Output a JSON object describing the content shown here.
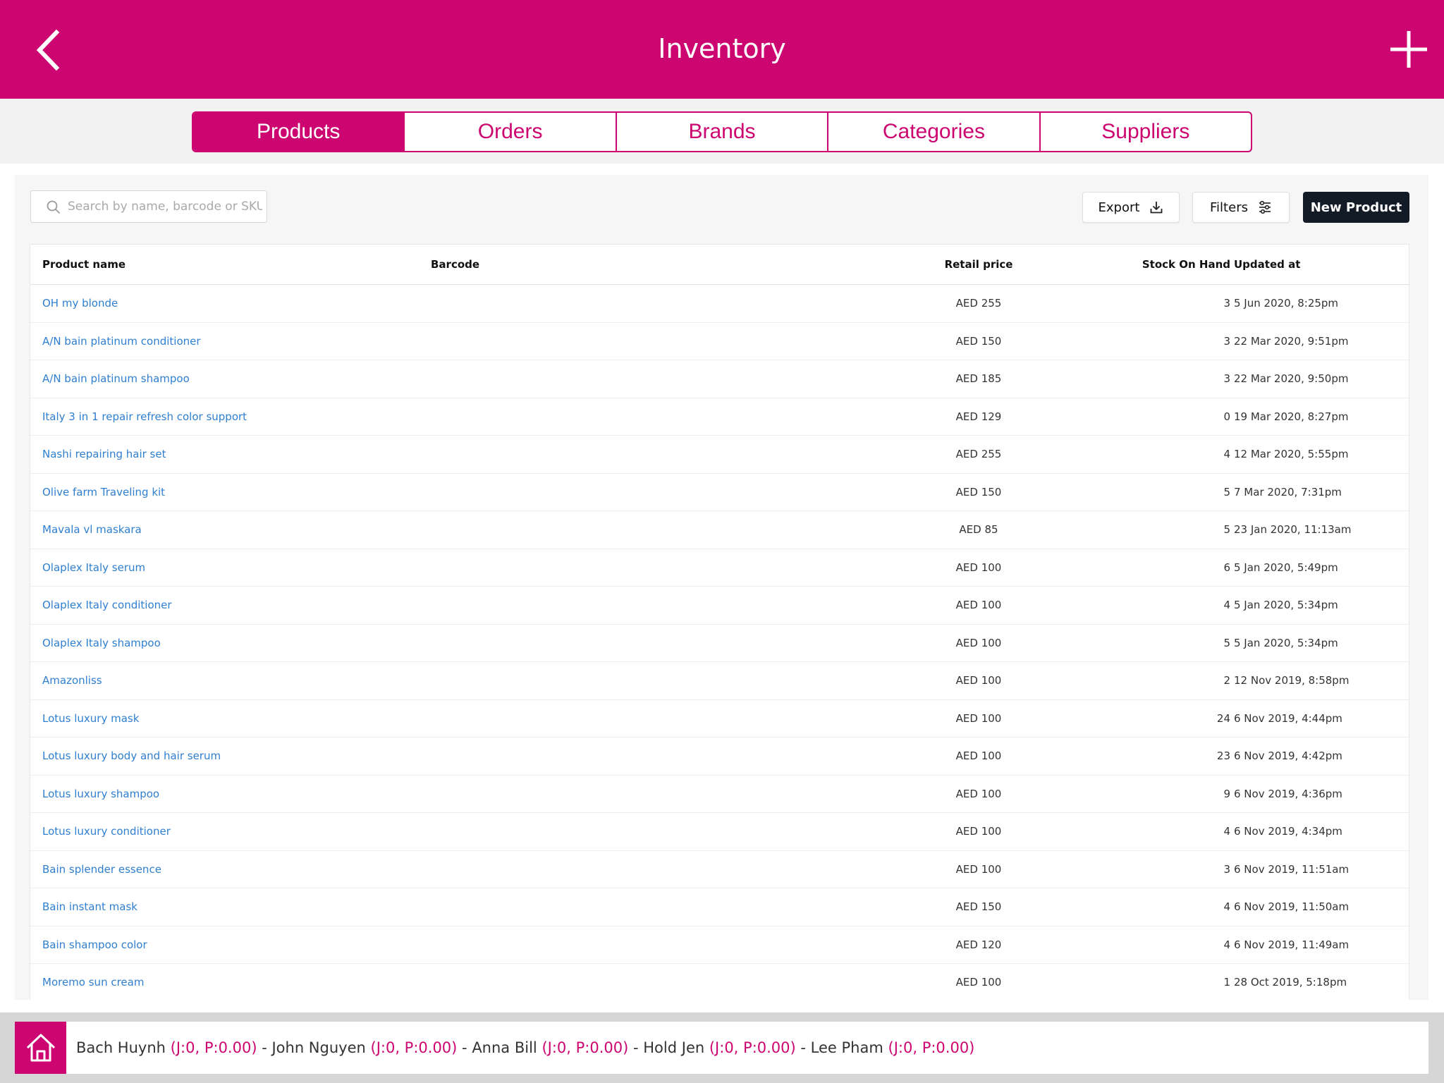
{
  "header": {
    "title": "Inventory",
    "accent_color": "#cc0570",
    "back_icon": "chevron-left-icon",
    "add_icon": "plus-icon"
  },
  "tabs": [
    {
      "label": "Products",
      "active": true
    },
    {
      "label": "Orders",
      "active": false
    },
    {
      "label": "Brands",
      "active": false
    },
    {
      "label": "Categories",
      "active": false
    },
    {
      "label": "Suppliers",
      "active": false
    }
  ],
  "toolbar": {
    "search_placeholder": "Search by name, barcode or SKU",
    "export_label": "Export",
    "filters_label": "Filters",
    "new_product_label": "New Product"
  },
  "table": {
    "columns": [
      "Product name",
      "Barcode",
      "Retail price",
      "Stock On Hand",
      "Updated at"
    ],
    "rows": [
      {
        "name": "OH my blonde",
        "barcode": "",
        "price": "AED 255",
        "stock": "3",
        "updated": "5 Jun 2020, 8:25pm"
      },
      {
        "name": "A/N bain platinum conditioner",
        "barcode": "",
        "price": "AED 150",
        "stock": "3",
        "updated": "22 Mar 2020, 9:51pm"
      },
      {
        "name": "A/N bain platinum shampoo",
        "barcode": "",
        "price": "AED 185",
        "stock": "3",
        "updated": "22 Mar 2020, 9:50pm"
      },
      {
        "name": "Italy 3 in 1 repair refresh color support",
        "barcode": "",
        "price": "AED 129",
        "stock": "0",
        "updated": "19 Mar 2020, 8:27pm"
      },
      {
        "name": "Nashi repairing hair set",
        "barcode": "",
        "price": "AED 255",
        "stock": "4",
        "updated": "12 Mar 2020, 5:55pm"
      },
      {
        "name": "Olive farm Traveling kit",
        "barcode": "",
        "price": "AED 150",
        "stock": "5",
        "updated": "7 Mar 2020, 7:31pm"
      },
      {
        "name": "Mavala vl maskara",
        "barcode": "",
        "price": "AED 85",
        "stock": "5",
        "updated": "23 Jan 2020, 11:13am"
      },
      {
        "name": "Olaplex Italy serum",
        "barcode": "",
        "price": "AED 100",
        "stock": "6",
        "updated": "5 Jan 2020, 5:49pm"
      },
      {
        "name": "Olaplex Italy conditioner",
        "barcode": "",
        "price": "AED 100",
        "stock": "4",
        "updated": "5 Jan 2020, 5:34pm"
      },
      {
        "name": "Olaplex Italy shampoo",
        "barcode": "",
        "price": "AED 100",
        "stock": "5",
        "updated": "5 Jan 2020, 5:34pm"
      },
      {
        "name": "Amazonliss",
        "barcode": "",
        "price": "AED 100",
        "stock": "2",
        "updated": "12 Nov 2019, 8:58pm"
      },
      {
        "name": "Lotus luxury mask",
        "barcode": "",
        "price": "AED 100",
        "stock": "24",
        "updated": "6 Nov 2019, 4:44pm"
      },
      {
        "name": "Lotus luxury body and hair serum",
        "barcode": "",
        "price": "AED 100",
        "stock": "23",
        "updated": "6 Nov 2019, 4:42pm"
      },
      {
        "name": "Lotus luxury shampoo",
        "barcode": "",
        "price": "AED 100",
        "stock": "9",
        "updated": "6 Nov 2019, 4:36pm"
      },
      {
        "name": "Lotus luxury conditioner",
        "barcode": "",
        "price": "AED 100",
        "stock": "4",
        "updated": "6 Nov 2019, 4:34pm"
      },
      {
        "name": "Bain splender essence",
        "barcode": "",
        "price": "AED 100",
        "stock": "3",
        "updated": "6 Nov 2019, 11:51am"
      },
      {
        "name": "Bain instant mask",
        "barcode": "",
        "price": "AED 150",
        "stock": "4",
        "updated": "6 Nov 2019, 11:50am"
      },
      {
        "name": "Bain shampoo color",
        "barcode": "",
        "price": "AED 120",
        "stock": "4",
        "updated": "6 Nov 2019, 11:49am"
      },
      {
        "name": "Moremo sun cream",
        "barcode": "",
        "price": "AED 100",
        "stock": "1",
        "updated": "28 Oct 2019, 5:18pm"
      }
    ]
  },
  "footer": {
    "home_icon": "home-icon",
    "staff": [
      {
        "name": "Bach Huynh",
        "stat": "(J:0, P:0.00)"
      },
      {
        "name": "John Nguyen",
        "stat": "(J:0, P:0.00)"
      },
      {
        "name": "Anna Bill",
        "stat": "(J:0, P:0.00)"
      },
      {
        "name": "Hold Jen",
        "stat": "(J:0, P:0.00)"
      },
      {
        "name": "Lee Pham",
        "stat": "(J:0, P:0.00)"
      }
    ],
    "separator": " - "
  }
}
